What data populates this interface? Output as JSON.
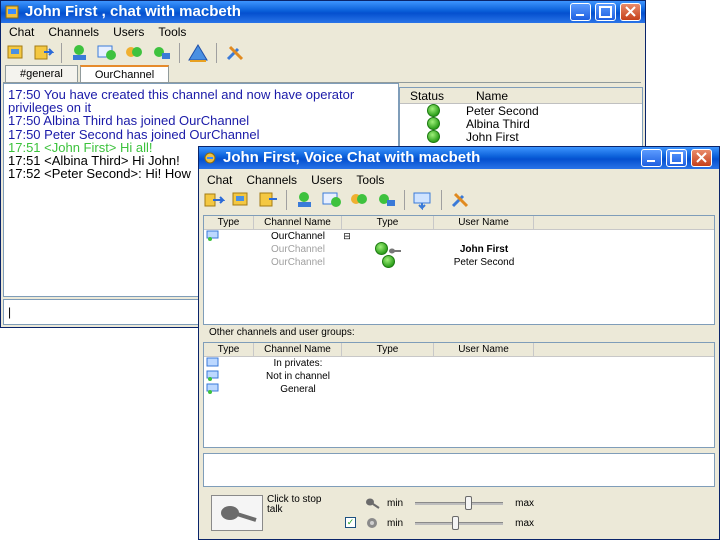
{
  "window1": {
    "title": "John First , chat with macbeth",
    "menu": [
      "Chat",
      "Channels",
      "Users",
      "Tools"
    ],
    "tabs": [
      "#general",
      "OurChannel"
    ],
    "chat_lines": [
      {
        "text": "17:50 You have created this channel and now have operator",
        "color": "blue"
      },
      {
        "text": "privileges on it",
        "color": "blue"
      },
      {
        "text": "17:50 Albina Third has joined OurChannel",
        "color": "blue"
      },
      {
        "text": "17:50 Peter Second has joined OurChannel",
        "color": "blue"
      },
      {
        "text": "17:51 <John First> Hi all!",
        "color": "green"
      },
      {
        "text": "17:51 <Albina Third> Hi John!",
        "color": "black"
      },
      {
        "text": "17:52 <Peter Second>: Hi! How",
        "color": "black"
      }
    ],
    "user_list": {
      "headers": {
        "status": "Status",
        "name": "Name"
      },
      "users": [
        "Peter Second",
        "Albina Third",
        "John First"
      ]
    },
    "input_value": "|"
  },
  "window2": {
    "title": "John First, Voice Chat with macbeth",
    "menu": [
      "Chat",
      "Channels",
      "Users",
      "Tools"
    ],
    "channels_grid": {
      "headers": [
        "Type",
        "Channel Name",
        "Type",
        "User Name"
      ],
      "rows": [
        {
          "channel": "OurChannel",
          "user": ""
        },
        {
          "channel": "OurChannel",
          "user": "John First"
        },
        {
          "channel": "OurChannel",
          "user": "Peter Second"
        }
      ]
    },
    "other_label": "Other channels and user groups:",
    "other_grid": {
      "headers": [
        "Type",
        "Channel Name",
        "Type",
        "User Name"
      ],
      "rows": [
        "In privates:",
        "Not in channel",
        "General"
      ]
    },
    "voice": {
      "talk_label": "Click to stop talk",
      "mic_min": "min",
      "mic_max": "max",
      "spk_min": "min",
      "spk_max": "max",
      "mic_level": 0.62,
      "speaker_level": 0.45,
      "checkbox_checked": true
    }
  },
  "colors": {
    "chat_blue": "#1a1aa8",
    "chat_green": "#3cc23c",
    "title_blue": "#0450cf"
  }
}
